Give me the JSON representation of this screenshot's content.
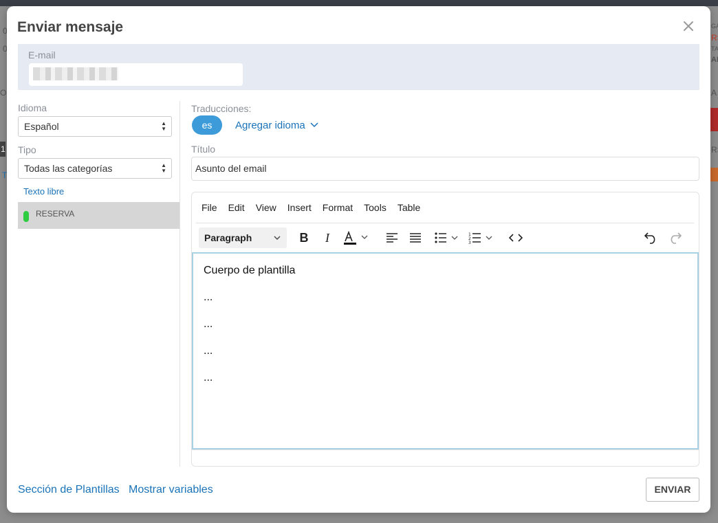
{
  "backdrop": {
    "left_fragments": [
      "0",
      "0",
      "OS",
      "1",
      "T"
    ],
    "right_fragments": [
      "GA",
      "RS",
      "TA",
      "ARS",
      "A",
      "RS"
    ]
  },
  "modal": {
    "title": "Enviar mensaje",
    "close_icon": "close-icon"
  },
  "email": {
    "label": "E-mail",
    "value": ""
  },
  "language": {
    "label": "Idioma",
    "selected": "Español"
  },
  "type": {
    "label": "Tipo",
    "selected": "Todas las categorías"
  },
  "free_text_link": "Texto libre",
  "templates": [
    {
      "label": "RESERVA",
      "color": "#2ecc40"
    }
  ],
  "translations": {
    "label": "Traducciones:",
    "active_lang": "es",
    "add_language": "Agregar idioma"
  },
  "title_field": {
    "label": "Título",
    "value": "Asunto del email"
  },
  "editor": {
    "menu": [
      "File",
      "Edit",
      "View",
      "Insert",
      "Format",
      "Tools",
      "Table"
    ],
    "block_format": "Paragraph",
    "body_lines": [
      "Cuerpo de plantilla",
      "...",
      "...",
      "...",
      "..."
    ]
  },
  "footer": {
    "templates_link": "Sección de Plantillas",
    "variables_link": "Mostrar variables",
    "send_button": "ENVIAR"
  },
  "colors": {
    "accent": "#3d9bd9",
    "link": "#1a73b8",
    "email_band": "#e6ebf3",
    "template_status": "#2ecc40"
  }
}
